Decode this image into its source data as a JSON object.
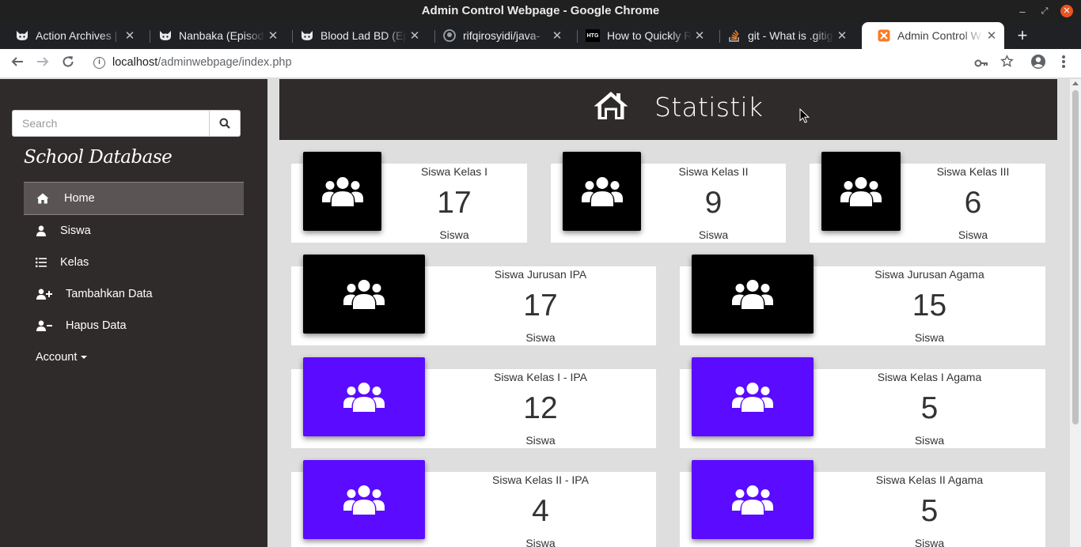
{
  "window": {
    "title": "Admin Control Webpage - Google Chrome",
    "close_color": "#e95420"
  },
  "tabs": [
    {
      "title": "Action Archives |",
      "icon": "cat-icon",
      "active": false
    },
    {
      "title": "Nanbaka (Episod",
      "icon": "cat-icon",
      "active": false
    },
    {
      "title": "Blood Lad BD (Ep",
      "icon": "cat-icon",
      "active": false
    },
    {
      "title": "rifqirosyidi/java-",
      "icon": "github-icon",
      "active": false
    },
    {
      "title": "How to Quickly R",
      "icon": "htg-icon",
      "active": false
    },
    {
      "title": "git - What is .gitig",
      "icon": "stackoverflow-icon",
      "active": false
    },
    {
      "title": "Admin Control W",
      "icon": "xampp-icon",
      "active": true
    }
  ],
  "htg_badge": "HTG",
  "address": {
    "host": "localhost",
    "path": "/adminwebpage/index.php",
    "info_glyph": "i"
  },
  "sidebar": {
    "search_placeholder": "Search",
    "brand": "School Database",
    "items": [
      {
        "label": "Home",
        "icon": "home-icon",
        "active": true
      },
      {
        "label": "Siswa",
        "icon": "user-icon",
        "active": false
      },
      {
        "label": "Kelas",
        "icon": "list-icon",
        "active": false
      },
      {
        "label": "Tambahkan Data",
        "icon": "user-plus-icon",
        "active": false
      },
      {
        "label": "Hapus Data",
        "icon": "user-minus-icon",
        "active": false
      }
    ],
    "account_label": "Account"
  },
  "header": {
    "title": "Statistik",
    "icon": "home-icon"
  },
  "colors": {
    "dark_panel": "#302b2b",
    "icon_black": "#000000",
    "icon_purple": "#5b0bff",
    "page_bg": "#dedede"
  },
  "stats": [
    {
      "label": "Siswa Kelas I",
      "value": "17",
      "unit": "Siswa",
      "color": "#000000"
    },
    {
      "label": "Siswa Kelas II",
      "value": "9",
      "unit": "Siswa",
      "color": "#000000"
    },
    {
      "label": "Siswa Kelas III",
      "value": "6",
      "unit": "Siswa",
      "color": "#000000"
    },
    {
      "label": "Siswa Jurusan IPA",
      "value": "17",
      "unit": "Siswa",
      "color": "#000000"
    },
    {
      "label": "Siswa Jurusan Agama",
      "value": "15",
      "unit": "Siswa",
      "color": "#000000"
    },
    {
      "label": "Siswa Kelas I - IPA",
      "value": "12",
      "unit": "Siswa",
      "color": "#5b0bff"
    },
    {
      "label": "Siswa Kelas I Agama",
      "value": "5",
      "unit": "Siswa",
      "color": "#5b0bff"
    },
    {
      "label": "Siswa Kelas II - IPA",
      "value": "4",
      "unit": "Siswa",
      "color": "#5b0bff"
    },
    {
      "label": "Siswa Kelas II Agama",
      "value": "5",
      "unit": "Siswa",
      "color": "#5b0bff"
    }
  ]
}
